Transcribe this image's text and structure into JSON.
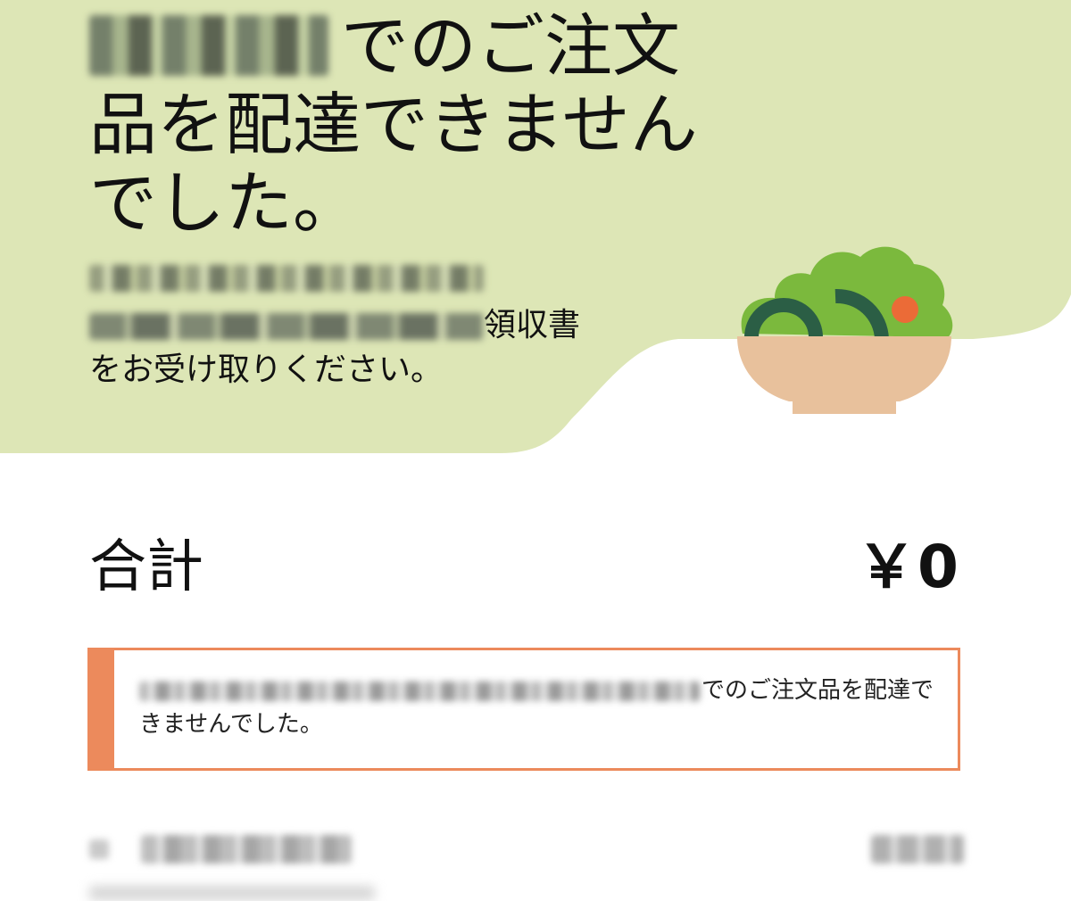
{
  "header": {
    "title_suffix": "でのご注文品を配達できませんでした。",
    "subtitle_part": "領収書",
    "subtitle_line2": "をお受け取りください。"
  },
  "summary": {
    "total_label": "合計",
    "total_value": "￥0"
  },
  "notice": {
    "message_suffix": "でのご注文品を配達できませんでした。"
  },
  "illustration": {
    "icon": "salad-bowl-icon"
  },
  "colors": {
    "hero_bg": "#dde6b6",
    "notice_accent": "#ec8a5c",
    "salad_green": "#7bb93d",
    "salad_dark": "#2b5e45",
    "tomato": "#eb6b37",
    "bowl": "#e8c19c"
  }
}
